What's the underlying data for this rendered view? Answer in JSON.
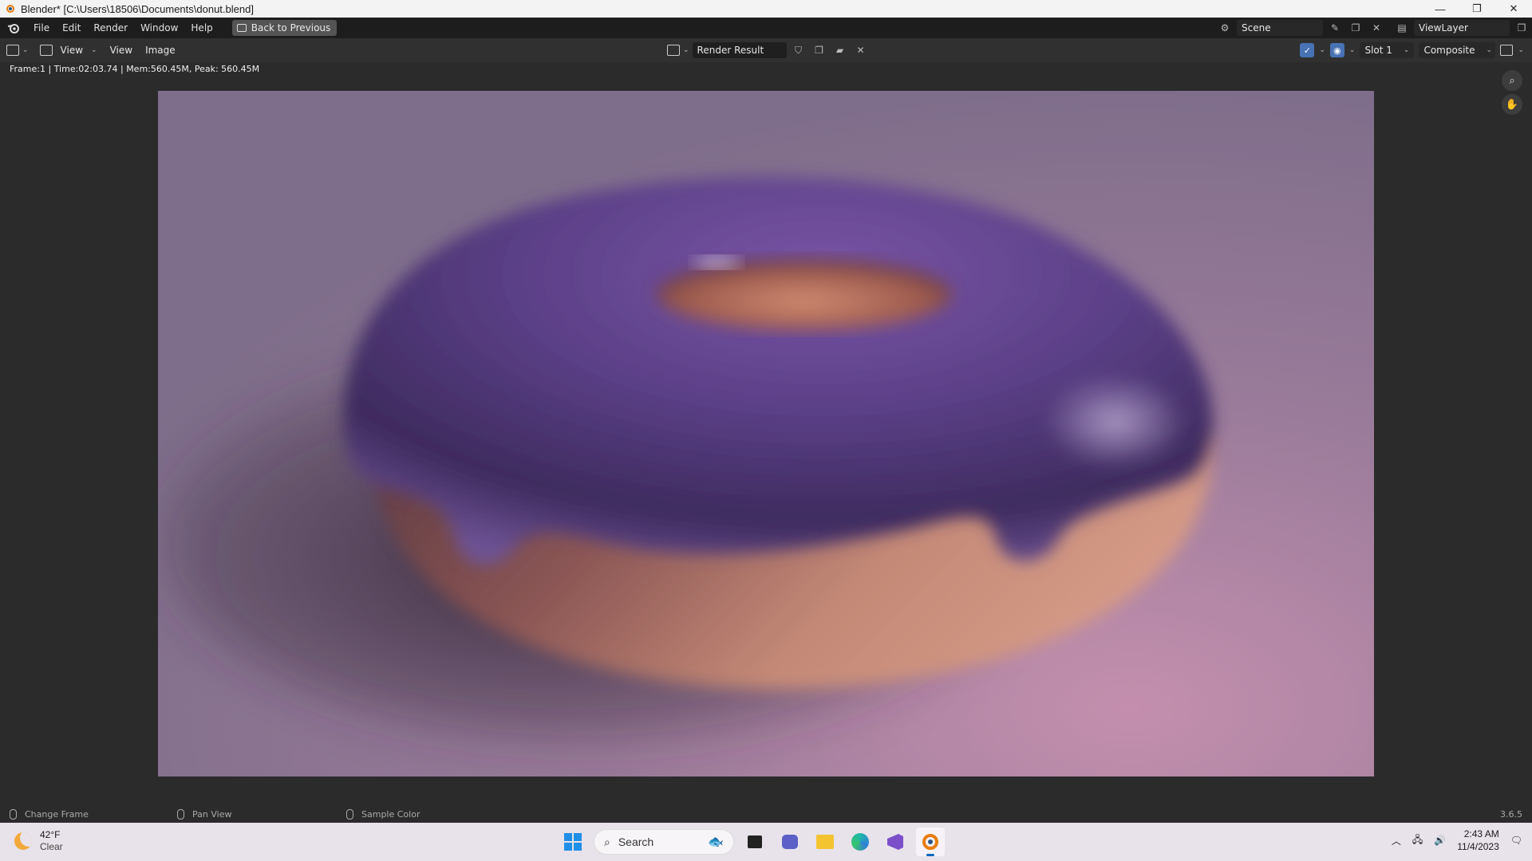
{
  "window": {
    "title": "Blender* [C:\\Users\\18506\\Documents\\donut.blend]",
    "controls": [
      "—",
      "❐",
      "✕"
    ]
  },
  "menu": {
    "items": [
      "File",
      "Edit",
      "Render",
      "Window",
      "Help"
    ],
    "back_button": "Back to Previous"
  },
  "scene": {
    "scene_name": "Scene",
    "view_layer": "ViewLayer"
  },
  "editor_header": {
    "view_dropdown": "View",
    "view_menu": "View",
    "image_menu": "Image",
    "image_name": "Render Result",
    "slot": "Slot 1",
    "layer": "Composite"
  },
  "stats": "Frame:1 | Time:02:03.74 | Mem:560.45M, Peak: 560.45M",
  "statusbar": {
    "change_frame": "Change Frame",
    "pan_view": "Pan View",
    "sample_color": "Sample Color",
    "version": "3.6.5"
  },
  "taskbar": {
    "weather_temp": "42°F",
    "weather_cond": "Clear",
    "search_placeholder": "Search",
    "time": "2:43 AM",
    "date": "11/4/2023"
  },
  "colors": {
    "blender_orange": "#e87d0d",
    "blender_blue": "#265787",
    "frosting": "#5a3f8a",
    "dough": "#c88a78",
    "background": "#8b7592"
  },
  "icons": {
    "zoom": "zoom-icon",
    "hand": "hand-icon"
  }
}
